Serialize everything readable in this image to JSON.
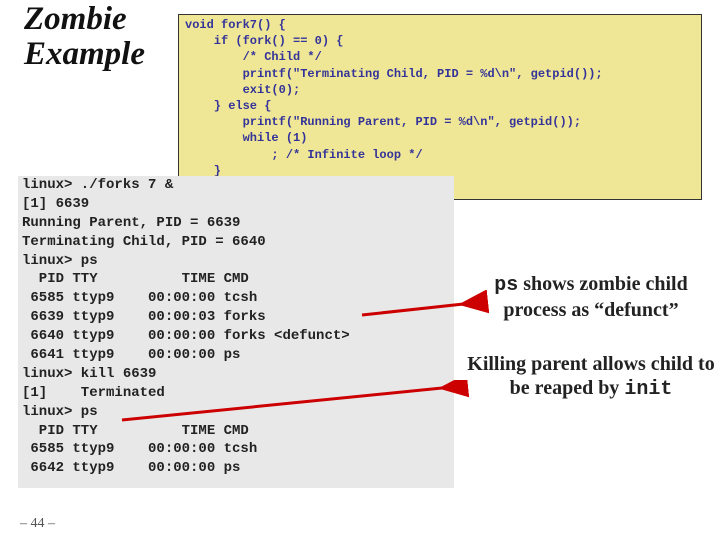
{
  "title": "Zombie\nExample",
  "code": "void fork7() {\n    if (fork() == 0) {\n        /* Child */\n        printf(\"Terminating Child, PID = %d\\n\", getpid());\n        exit(0);\n    } else {\n        printf(\"Running Parent, PID = %d\\n\", getpid());\n        while (1)\n            ; /* Infinite loop */\n    }\n}",
  "terminal": "linux> ./forks 7 &\n[1] 6639\nRunning Parent, PID = 6639\nTerminating Child, PID = 6640\nlinux> ps\n  PID TTY          TIME CMD\n 6585 ttyp9    00:00:00 tcsh\n 6639 ttyp9    00:00:03 forks\n 6640 ttyp9    00:00:00 forks <defunct>\n 6641 ttyp9    00:00:00 ps\nlinux> kill 6639\n[1]    Terminated\nlinux> ps\n  PID TTY          TIME CMD\n 6585 ttyp9    00:00:00 tcsh\n 6642 ttyp9    00:00:00 ps",
  "annotations": {
    "a1_pre": "ps",
    "a1_mid": " shows zombie child process as “defunct”",
    "a2_pre": "Killing parent allows child to be reaped by ",
    "a2_post": "init"
  },
  "page": "– 44 –"
}
